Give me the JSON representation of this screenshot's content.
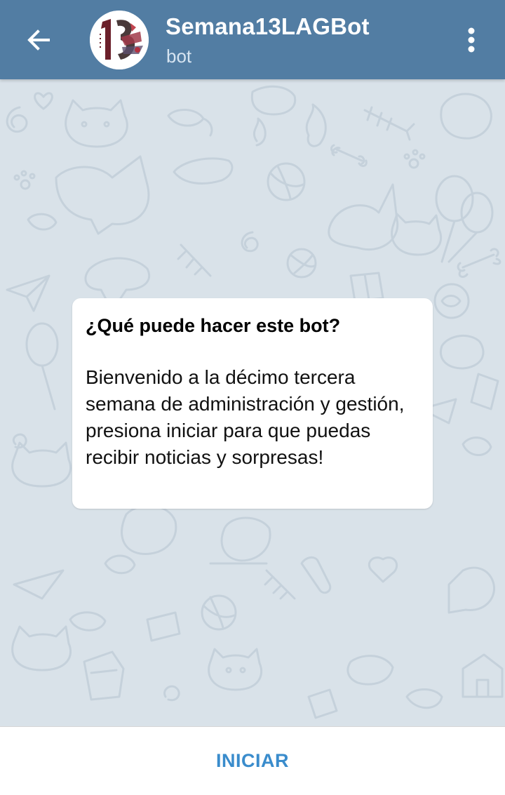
{
  "header": {
    "title": "Semana13LAGBot",
    "subtitle": "bot",
    "back_icon": "arrow-left-icon",
    "menu_icon": "more-vertical-icon",
    "avatar_icon": "semana-13-logo",
    "background_color": "#527da3"
  },
  "info_card": {
    "title": "¿Qué puede hacer este bot?",
    "body": "Bienvenido a la décimo tercera semana de administración y gestión, presiona iniciar para que puedas recibir noticias y sorpresas!"
  },
  "bottom_bar": {
    "start_label": "INICIAR",
    "accent_color": "#3a8ccc"
  },
  "chat": {
    "background_color": "#d9e2e9"
  }
}
